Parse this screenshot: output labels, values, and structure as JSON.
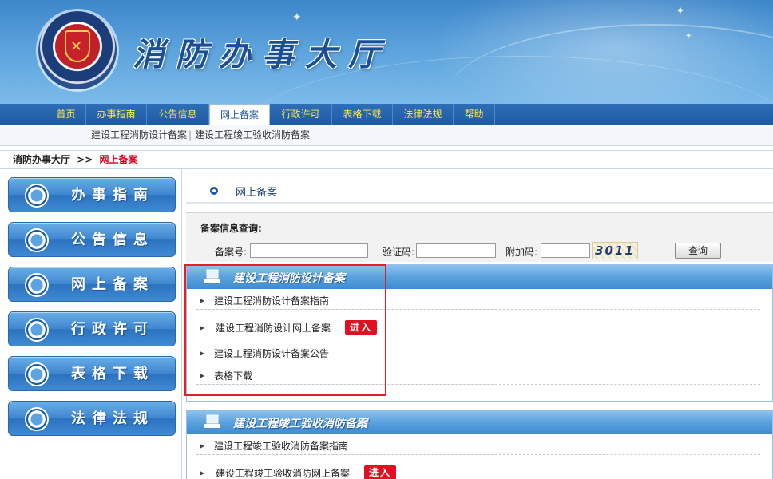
{
  "header": {
    "title": "消防办事大厅",
    "emblem_icon": "fire-service-emblem"
  },
  "nav": {
    "items": [
      {
        "label": "首页"
      },
      {
        "label": "办事指南"
      },
      {
        "label": "公告信息"
      },
      {
        "label": "网上备案",
        "active": true
      },
      {
        "label": "行政许可"
      },
      {
        "label": "表格下载"
      },
      {
        "label": "法律法规"
      },
      {
        "label": "帮助"
      }
    ]
  },
  "subnav": {
    "items": [
      "建设工程消防设计备案",
      "建设工程竣工验收消防备案"
    ],
    "separator": "|"
  },
  "breadcrumb": {
    "home": "消防办事大厅",
    "arrow": ">>",
    "current": "网上备案"
  },
  "sidebar": {
    "items": [
      "办事指南",
      "公告信息",
      "网上备案",
      "行政许可",
      "表格下载",
      "法律法规"
    ]
  },
  "main": {
    "section_title": "网上备案",
    "query": {
      "title": "备案信息查询:",
      "record_no_label": "备案号:",
      "record_no_value": "",
      "captcha_label": "验证码:",
      "captcha_value": "",
      "extra_code_label": "附加码:",
      "extra_code_value": "",
      "captcha_image_text": "3011",
      "search_button": "查询"
    },
    "panels": [
      {
        "title": "建设工程消防设计备案",
        "rows": [
          {
            "text": "建设工程消防设计备案指南"
          },
          {
            "text": "建设工程消防设计网上备案",
            "enter": "进入"
          },
          {
            "text": "建设工程消防设计备案公告"
          },
          {
            "text": "表格下载"
          }
        ]
      },
      {
        "title": "建设工程竣工验收消防备案",
        "rows": [
          {
            "text": "建设工程竣工验收消防备案指南"
          },
          {
            "text": "建设工程竣工验收消防网上备案",
            "enter": "进入"
          }
        ]
      }
    ]
  },
  "colors": {
    "nav_text": "#ffe64d",
    "accent_blue": "#1d5aa3",
    "highlight_red": "#e0202a",
    "enter_red": "#e01020"
  }
}
